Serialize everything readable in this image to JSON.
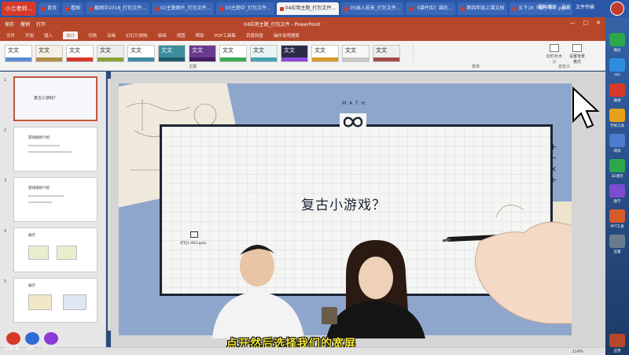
{
  "browser": {
    "brand_label": "小兰老师...",
    "tabs": [
      {
        "label": "首页"
      },
      {
        "label": "看图"
      },
      {
        "label": "截图中2018_打包文件..."
      },
      {
        "label": "02主题图片_打包文件..."
      },
      {
        "label": "03主题中_打包文件..."
      },
      {
        "label": "04应用主题_打包文件...",
        "active": true
      },
      {
        "label": "05插入前景_打包文件..."
      },
      {
        "label": "《课件库》课后..."
      },
      {
        "label": "第四年级上课文档"
      },
      {
        "label": "五下16《帽子等》.pptx"
      }
    ],
    "right_controls": [
      "福利活动",
      "会员",
      "文件传输"
    ]
  },
  "app": {
    "doc_title": "04应用主题_打包文件 - PowerPoint",
    "quick_access": [
      "保存",
      "撤销",
      "打开"
    ],
    "window_controls": [
      "—",
      "□",
      "✕"
    ],
    "ribbon_tabs": [
      "文件",
      "开始",
      "插入",
      "设计",
      "切换",
      "动画",
      "幻灯片放映",
      "审阅",
      "视图",
      "帮助",
      "PDF工具集",
      "百度网盘",
      "操作说明搜索"
    ],
    "active_ribbon_tab": "设计",
    "theme_group_label": "主题",
    "variant_group_label": "变体",
    "customize_group_label": "自定义",
    "theme_sample_text": "文文",
    "ribbon_buttons": [
      {
        "label": "幻灯片大小"
      },
      {
        "label": "设置背景格式"
      }
    ]
  },
  "thumbnails": {
    "slides": [
      {
        "number": "1",
        "title": "复古小游戏？",
        "selected": true
      },
      {
        "number": "2",
        "title": "游戏规则介绍"
      },
      {
        "number": "3",
        "title": "游戏规则介绍"
      },
      {
        "number": "4",
        "title": "展示"
      },
      {
        "number": "5",
        "title": "展示"
      }
    ]
  },
  "slide": {
    "title": "复古小游戏？",
    "badge": "MATH",
    "ops": [
      "+",
      "−",
      "×",
      "÷"
    ],
    "file_label": "打包1-483.pptx"
  },
  "caption": "点开然后选择我们的宽屏",
  "status": {
    "zoom": "114%"
  },
  "desktop_icons": [
    {
      "label": "微信",
      "color": "#2aa84a"
    },
    {
      "label": "QQ",
      "color": "#2e8de0"
    },
    {
      "label": "微博",
      "color": "#d6392a"
    },
    {
      "label": "学校工具",
      "color": "#e7a21c"
    },
    {
      "label": "阅读",
      "color": "#4c7bd0"
    },
    {
      "label": "3D演示",
      "color": "#2aa84a"
    },
    {
      "label": "教学",
      "color": "#7b4cd0"
    },
    {
      "label": "PPT工具",
      "color": "#d65a2a"
    },
    {
      "label": "设置",
      "color": "#6a7b8c"
    },
    {
      "label": "应用",
      "color": "#b7472a"
    }
  ],
  "bottom_left_labels": [
    "新建页面",
    "视频",
    "卡片学习"
  ]
}
